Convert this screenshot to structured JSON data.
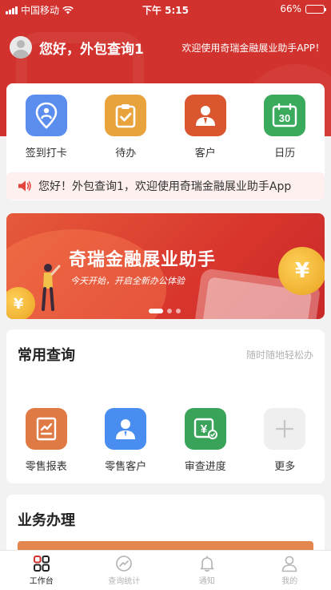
{
  "status_bar": {
    "carrier": "中国移动",
    "time": "下午 5:15",
    "battery": "66%",
    "battery_level": 0.66
  },
  "header": {
    "greeting": "您好，外包查询1",
    "welcome": "欢迎使用奇瑞金融展业助手APP！"
  },
  "shortcuts": [
    {
      "label": "签到打卡",
      "icon": "location-pin-icon",
      "color": "#5b8def"
    },
    {
      "label": "待办",
      "icon": "clipboard-check-icon",
      "color": "#e8a33d"
    },
    {
      "label": "客户",
      "icon": "person-icon",
      "color": "#d9562f"
    },
    {
      "label": "日历",
      "icon": "calendar-icon",
      "color": "#3aaa5c",
      "day": "30"
    }
  ],
  "notice": {
    "text": "您好！外包查询1，欢迎使用奇瑞金融展业助手App"
  },
  "banner": {
    "title": "奇瑞金融展业助手",
    "subtitle": "今天开始，开启全新办公体验",
    "coin_symbol": "¥"
  },
  "common_query": {
    "title": "常用查询",
    "subtitle": "随时随地轻松办",
    "items": [
      {
        "label": "零售报表",
        "icon": "report-chart-icon",
        "color": "#e07a45"
      },
      {
        "label": "零售客户",
        "icon": "customer-icon",
        "color": "#4a8df0"
      },
      {
        "label": "审查进度",
        "icon": "review-progress-icon",
        "color": "#3aa35a"
      },
      {
        "label": "更多",
        "icon": "plus-icon",
        "color": "#efefef"
      }
    ]
  },
  "business": {
    "title": "业务办理"
  },
  "tabbar": [
    {
      "label": "工作台",
      "icon": "grid-apps-icon",
      "active": true
    },
    {
      "label": "查询统计",
      "icon": "stats-gauge-icon",
      "active": false
    },
    {
      "label": "通知",
      "icon": "bell-icon",
      "active": false
    },
    {
      "label": "我的",
      "icon": "user-profile-icon",
      "active": false
    }
  ]
}
